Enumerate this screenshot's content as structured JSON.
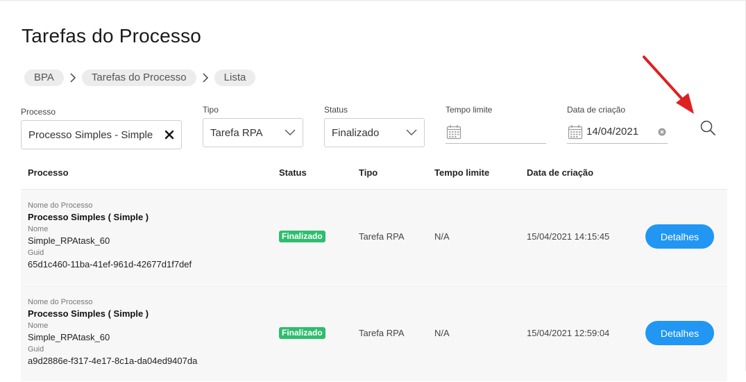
{
  "page": {
    "title": "Tarefas do Processo"
  },
  "breadcrumb": [
    "BPA",
    "Tarefas do Processo",
    "Lista"
  ],
  "filters": {
    "processo": {
      "label": "Processo",
      "value": "Processo Simples - Simple"
    },
    "tipo": {
      "label": "Tipo",
      "value": "Tarefa RPA"
    },
    "status": {
      "label": "Status",
      "value": "Finalizado"
    },
    "tempo_limite": {
      "label": "Tempo limite",
      "value": ""
    },
    "data_criacao": {
      "label": "Data de criação",
      "value": "14/04/2021"
    }
  },
  "table": {
    "headers": {
      "processo": "Processo",
      "status": "Status",
      "tipo": "Tipo",
      "tempo_limite": "Tempo limite",
      "data_criacao": "Data de criação"
    },
    "field_labels": {
      "nome_processo": "Nome do Processo",
      "nome": "Nome",
      "guid": "Guid"
    },
    "rows": [
      {
        "process_name": "Processo Simples ( Simple )",
        "name": "Simple_RPAtask_60",
        "guid": "65d1c460-11ba-41ef-961d-42677d1f7def",
        "status": "Finalizado",
        "tipo": "Tarefa RPA",
        "tempo_limite": "N/A",
        "data_criacao": "15/04/2021 14:15:45",
        "action": "Detalhes"
      },
      {
        "process_name": "Processo Simples ( Simple )",
        "name": "Simple_RPAtask_60",
        "guid": "a9d2886e-f317-4e17-8c1a-da04ed9407da",
        "status": "Finalizado",
        "tipo": "Tarefa RPA",
        "tempo_limite": "N/A",
        "data_criacao": "15/04/2021 12:59:04",
        "action": "Detalhes"
      }
    ]
  },
  "icons": {
    "breadcrumb_separator": "chevron-right-icon",
    "clear": "close-icon",
    "dropdown": "chevron-down-icon",
    "calendar": "calendar-icon",
    "clear_date": "clear-circle-icon",
    "search": "search-icon",
    "annotation": "red-arrow"
  },
  "colors": {
    "badge": "#2ebd6e",
    "primary_button": "#2196f3",
    "annotation_arrow": "#e02020"
  }
}
